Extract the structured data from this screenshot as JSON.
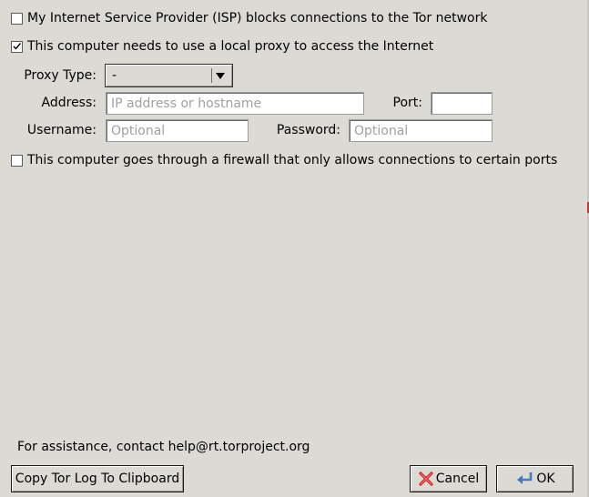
{
  "checkboxes": {
    "isp": {
      "label": "My Internet Service Provider (ISP) blocks connections to the Tor network",
      "checked": false
    },
    "proxy": {
      "label": "This computer needs to use a local proxy to access the Internet",
      "checked": true
    },
    "firewall": {
      "label": "This computer goes through a firewall that only allows connections to certain ports",
      "checked": false
    }
  },
  "proxy": {
    "type_label": "Proxy Type:",
    "type_value": "-",
    "address_label": "Address:",
    "address_placeholder": "IP address or hostname",
    "address_value": "",
    "port_label": "Port:",
    "port_value": "",
    "username_label": "Username:",
    "username_placeholder": "Optional",
    "username_value": "",
    "password_label": "Password:",
    "password_placeholder": "Optional",
    "password_value": ""
  },
  "footer": {
    "assistance": "For assistance, contact help@rt.torproject.org",
    "copy_log_label": "Copy Tor Log To Clipboard",
    "cancel_label": "Cancel",
    "ok_label": "OK"
  },
  "icons": {
    "cancel": "red-x-icon",
    "ok": "return-arrow-icon"
  },
  "colors": {
    "background": "#dcdad5",
    "cancel_icon": "#cc1f1f",
    "ok_icon": "#4a78c0"
  }
}
